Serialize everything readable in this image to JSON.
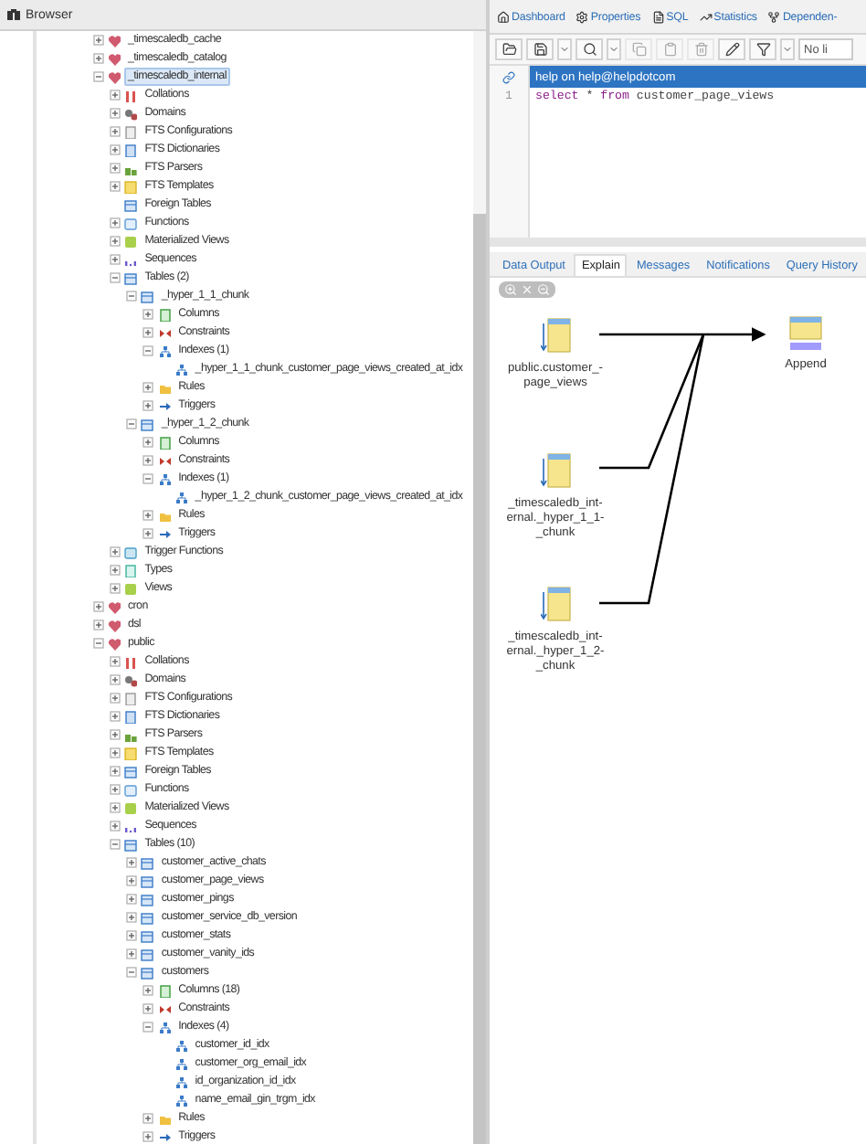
{
  "browser": {
    "title": "Browser",
    "tree": [
      {
        "label": "_timescaledb_cache",
        "kind": "schema",
        "expanded": false,
        "selected": false
      },
      {
        "label": "_timescaledb_catalog",
        "kind": "schema",
        "expanded": false,
        "selected": false
      },
      {
        "label": "_timescaledb_internal",
        "kind": "schema",
        "expanded": true,
        "selected": true,
        "children": [
          {
            "label": "Collations",
            "kind": "collation",
            "expanded": false,
            "selected": false
          },
          {
            "label": "Domains",
            "kind": "domain",
            "expanded": false,
            "selected": false
          },
          {
            "label": "FTS Configurations",
            "kind": "fts-config",
            "expanded": false,
            "selected": false
          },
          {
            "label": "FTS Dictionaries",
            "kind": "fts-dict",
            "expanded": false,
            "selected": false
          },
          {
            "label": "FTS Parsers",
            "kind": "fts-parser",
            "expanded": false,
            "selected": false
          },
          {
            "label": "FTS Templates",
            "kind": "fts-template",
            "expanded": false,
            "selected": false
          },
          {
            "label": "Foreign Tables",
            "kind": "foreign-table",
            "selected": false
          },
          {
            "label": "Functions",
            "kind": "function",
            "expanded": false,
            "selected": false
          },
          {
            "label": "Materialized Views",
            "kind": "matview",
            "expanded": false,
            "selected": false
          },
          {
            "label": "Sequences",
            "kind": "sequence",
            "expanded": false,
            "selected": false
          },
          {
            "label": "Tables (2)",
            "kind": "tables",
            "expanded": true,
            "selected": false,
            "children": [
              {
                "label": "_hyper_1_1_chunk",
                "kind": "table",
                "expanded": true,
                "selected": false,
                "children": [
                  {
                    "label": "Columns",
                    "kind": "columns",
                    "expanded": false,
                    "selected": false
                  },
                  {
                    "label": "Constraints",
                    "kind": "constraints",
                    "expanded": false,
                    "selected": false
                  },
                  {
                    "label": "Indexes (1)",
                    "kind": "indexes",
                    "expanded": true,
                    "selected": false,
                    "children": [
                      {
                        "label": "_hyper_1_1_chunk_customer_page_views_created_at_idx",
                        "kind": "index",
                        "selected": false
                      }
                    ]
                  },
                  {
                    "label": "Rules",
                    "kind": "rules",
                    "expanded": false,
                    "selected": false
                  },
                  {
                    "label": "Triggers",
                    "kind": "triggers",
                    "expanded": false,
                    "selected": false
                  }
                ]
              },
              {
                "label": "_hyper_1_2_chunk",
                "kind": "table",
                "expanded": true,
                "selected": false,
                "children": [
                  {
                    "label": "Columns",
                    "kind": "columns",
                    "expanded": false,
                    "selected": false
                  },
                  {
                    "label": "Constraints",
                    "kind": "constraints",
                    "expanded": false,
                    "selected": false
                  },
                  {
                    "label": "Indexes (1)",
                    "kind": "indexes",
                    "expanded": true,
                    "selected": false,
                    "children": [
                      {
                        "label": "_hyper_1_2_chunk_customer_page_views_created_at_idx",
                        "kind": "index",
                        "selected": false
                      }
                    ]
                  },
                  {
                    "label": "Rules",
                    "kind": "rules",
                    "expanded": false,
                    "selected": false
                  },
                  {
                    "label": "Triggers",
                    "kind": "triggers",
                    "expanded": false,
                    "selected": false
                  }
                ]
              }
            ]
          },
          {
            "label": "Trigger Functions",
            "kind": "trigger-function",
            "expanded": false,
            "selected": false
          },
          {
            "label": "Types",
            "kind": "type",
            "expanded": false,
            "selected": false
          },
          {
            "label": "Views",
            "kind": "views",
            "expanded": false,
            "selected": false
          }
        ]
      },
      {
        "label": "cron",
        "kind": "schema",
        "expanded": false,
        "selected": false
      },
      {
        "label": "dsl",
        "kind": "schema",
        "expanded": false,
        "selected": false
      },
      {
        "label": "public",
        "kind": "schema",
        "expanded": true,
        "selected": false,
        "children": [
          {
            "label": "Collations",
            "kind": "collation",
            "expanded": false,
            "selected": false
          },
          {
            "label": "Domains",
            "kind": "domain",
            "expanded": false,
            "selected": false
          },
          {
            "label": "FTS Configurations",
            "kind": "fts-config",
            "expanded": false,
            "selected": false
          },
          {
            "label": "FTS Dictionaries",
            "kind": "fts-dict",
            "expanded": false,
            "selected": false
          },
          {
            "label": "FTS Parsers",
            "kind": "fts-parser",
            "expanded": false,
            "selected": false
          },
          {
            "label": "FTS Templates",
            "kind": "fts-template",
            "expanded": false,
            "selected": false
          },
          {
            "label": "Foreign Tables",
            "kind": "foreign-table",
            "expanded": false,
            "selected": false
          },
          {
            "label": "Functions",
            "kind": "function",
            "expanded": false,
            "selected": false
          },
          {
            "label": "Materialized Views",
            "kind": "matview",
            "expanded": false,
            "selected": false
          },
          {
            "label": "Sequences",
            "kind": "sequence",
            "expanded": false,
            "selected": false
          },
          {
            "label": "Tables (10)",
            "kind": "tables",
            "expanded": true,
            "selected": false,
            "children": [
              {
                "label": "customer_active_chats",
                "kind": "table",
                "expanded": false,
                "selected": false
              },
              {
                "label": "customer_page_views",
                "kind": "table",
                "expanded": false,
                "selected": false
              },
              {
                "label": "customer_pings",
                "kind": "table",
                "expanded": false,
                "selected": false
              },
              {
                "label": "customer_service_db_version",
                "kind": "table",
                "expanded": false,
                "selected": false
              },
              {
                "label": "customer_stats",
                "kind": "table",
                "expanded": false,
                "selected": false
              },
              {
                "label": "customer_vanity_ids",
                "kind": "table",
                "expanded": false,
                "selected": false
              },
              {
                "label": "customers",
                "kind": "table",
                "expanded": true,
                "selected": false,
                "children": [
                  {
                    "label": "Columns (18)",
                    "kind": "columns",
                    "expanded": false,
                    "selected": false
                  },
                  {
                    "label": "Constraints",
                    "kind": "constraints",
                    "expanded": false,
                    "selected": false
                  },
                  {
                    "label": "Indexes (4)",
                    "kind": "indexes",
                    "expanded": true,
                    "selected": false,
                    "children": [
                      {
                        "label": "customer_id_idx",
                        "kind": "index",
                        "selected": false
                      },
                      {
                        "label": "customer_org_email_idx",
                        "kind": "index",
                        "selected": false
                      },
                      {
                        "label": "id_organization_id_idx",
                        "kind": "index",
                        "selected": false
                      },
                      {
                        "label": "name_email_gin_trgm_idx",
                        "kind": "index",
                        "selected": false
                      }
                    ]
                  },
                  {
                    "label": "Rules",
                    "kind": "rules",
                    "expanded": false,
                    "selected": false
                  },
                  {
                    "label": "Triggers",
                    "kind": "triggers",
                    "expanded": false,
                    "selected": false
                  }
                ]
              }
            ]
          }
        ]
      }
    ]
  },
  "tabs": [
    {
      "label": "Dashboard",
      "selected": false
    },
    {
      "label": "Properties",
      "selected": false
    },
    {
      "label": "SQL",
      "selected": false
    },
    {
      "label": "Statistics",
      "selected": false
    },
    {
      "label": "Dependen-",
      "selected": false
    }
  ],
  "toolbar": {
    "buttons": [
      {
        "disabled": false
      },
      {
        "disabled": false
      },
      {
        "disabled": false
      },
      {
        "disabled": false
      },
      {
        "disabled": false
      },
      {
        "disabled": true
      },
      {
        "disabled": true
      },
      {
        "disabled": true
      },
      {
        "disabled": false
      },
      {
        "disabled": false
      },
      {
        "disabled": false
      }
    ],
    "limit_select": {
      "value": "No li"
    }
  },
  "connection": {
    "label": "help on help@helpdotcom"
  },
  "editor": {
    "lines": [
      {
        "number": "1",
        "tokens": [
          {
            "text": "select",
            "kind": "keyword"
          },
          {
            "text": " * ",
            "kind": "plain"
          },
          {
            "text": "from",
            "kind": "keyword"
          },
          {
            "text": " customer_page_views",
            "kind": "plain"
          }
        ]
      }
    ]
  },
  "result_tabs": [
    {
      "label": "Data Output",
      "selected": false
    },
    {
      "label": "Explain",
      "selected": true
    },
    {
      "label": "Messages",
      "selected": false
    },
    {
      "label": "Notifications",
      "selected": false
    },
    {
      "label": "Query History",
      "selected": false
    }
  ],
  "explain": {
    "nodes": [
      {
        "label": "public.customer_-\npage_views",
        "kind": "scan"
      },
      {
        "label": "_timescaledb_int-\nernal._hyper_1_1-\n_chunk",
        "kind": "scan"
      },
      {
        "label": "_timescaledb_int-\nernal._hyper_1_2-\n_chunk",
        "kind": "scan"
      },
      {
        "label": "Append",
        "kind": "append"
      }
    ]
  }
}
